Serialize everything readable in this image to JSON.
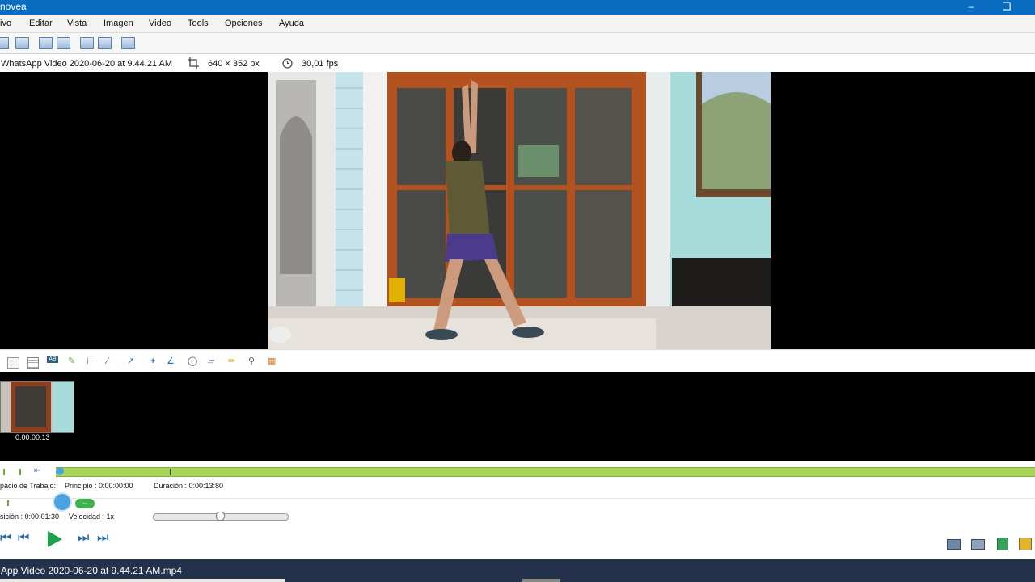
{
  "window": {
    "title": "novea"
  },
  "menu": [
    "ivo",
    "Editar",
    "Vista",
    "Imagen",
    "Video",
    "Tools",
    "Opciones",
    "Ayuda"
  ],
  "info": {
    "filename": "WhatsApp Video 2020-06-20 at 9.44.21 AM",
    "resolution": "640 × 352 px",
    "framerate": "30,01 fps"
  },
  "thumbnail": {
    "time": "0:00:00:13"
  },
  "timeline": {
    "workspace_label": "pacio de Trabajo:",
    "start": "Principio : 0:00:00:00",
    "duration": "Duración : 0:00:13:80",
    "position": "sición : 0:00:01:30",
    "speed": "Velocidad : 1x",
    "progress": 0.0,
    "speed_slider": 0.5
  },
  "status": {
    "file": "App Video 2020-06-20 at 9.44.21 AM.mp4"
  },
  "colors": {
    "titlebar": "#0a6cc1",
    "timeline_green": "#a8d45a",
    "play_green": "#1aa34a",
    "statusbar": "#23314a"
  }
}
